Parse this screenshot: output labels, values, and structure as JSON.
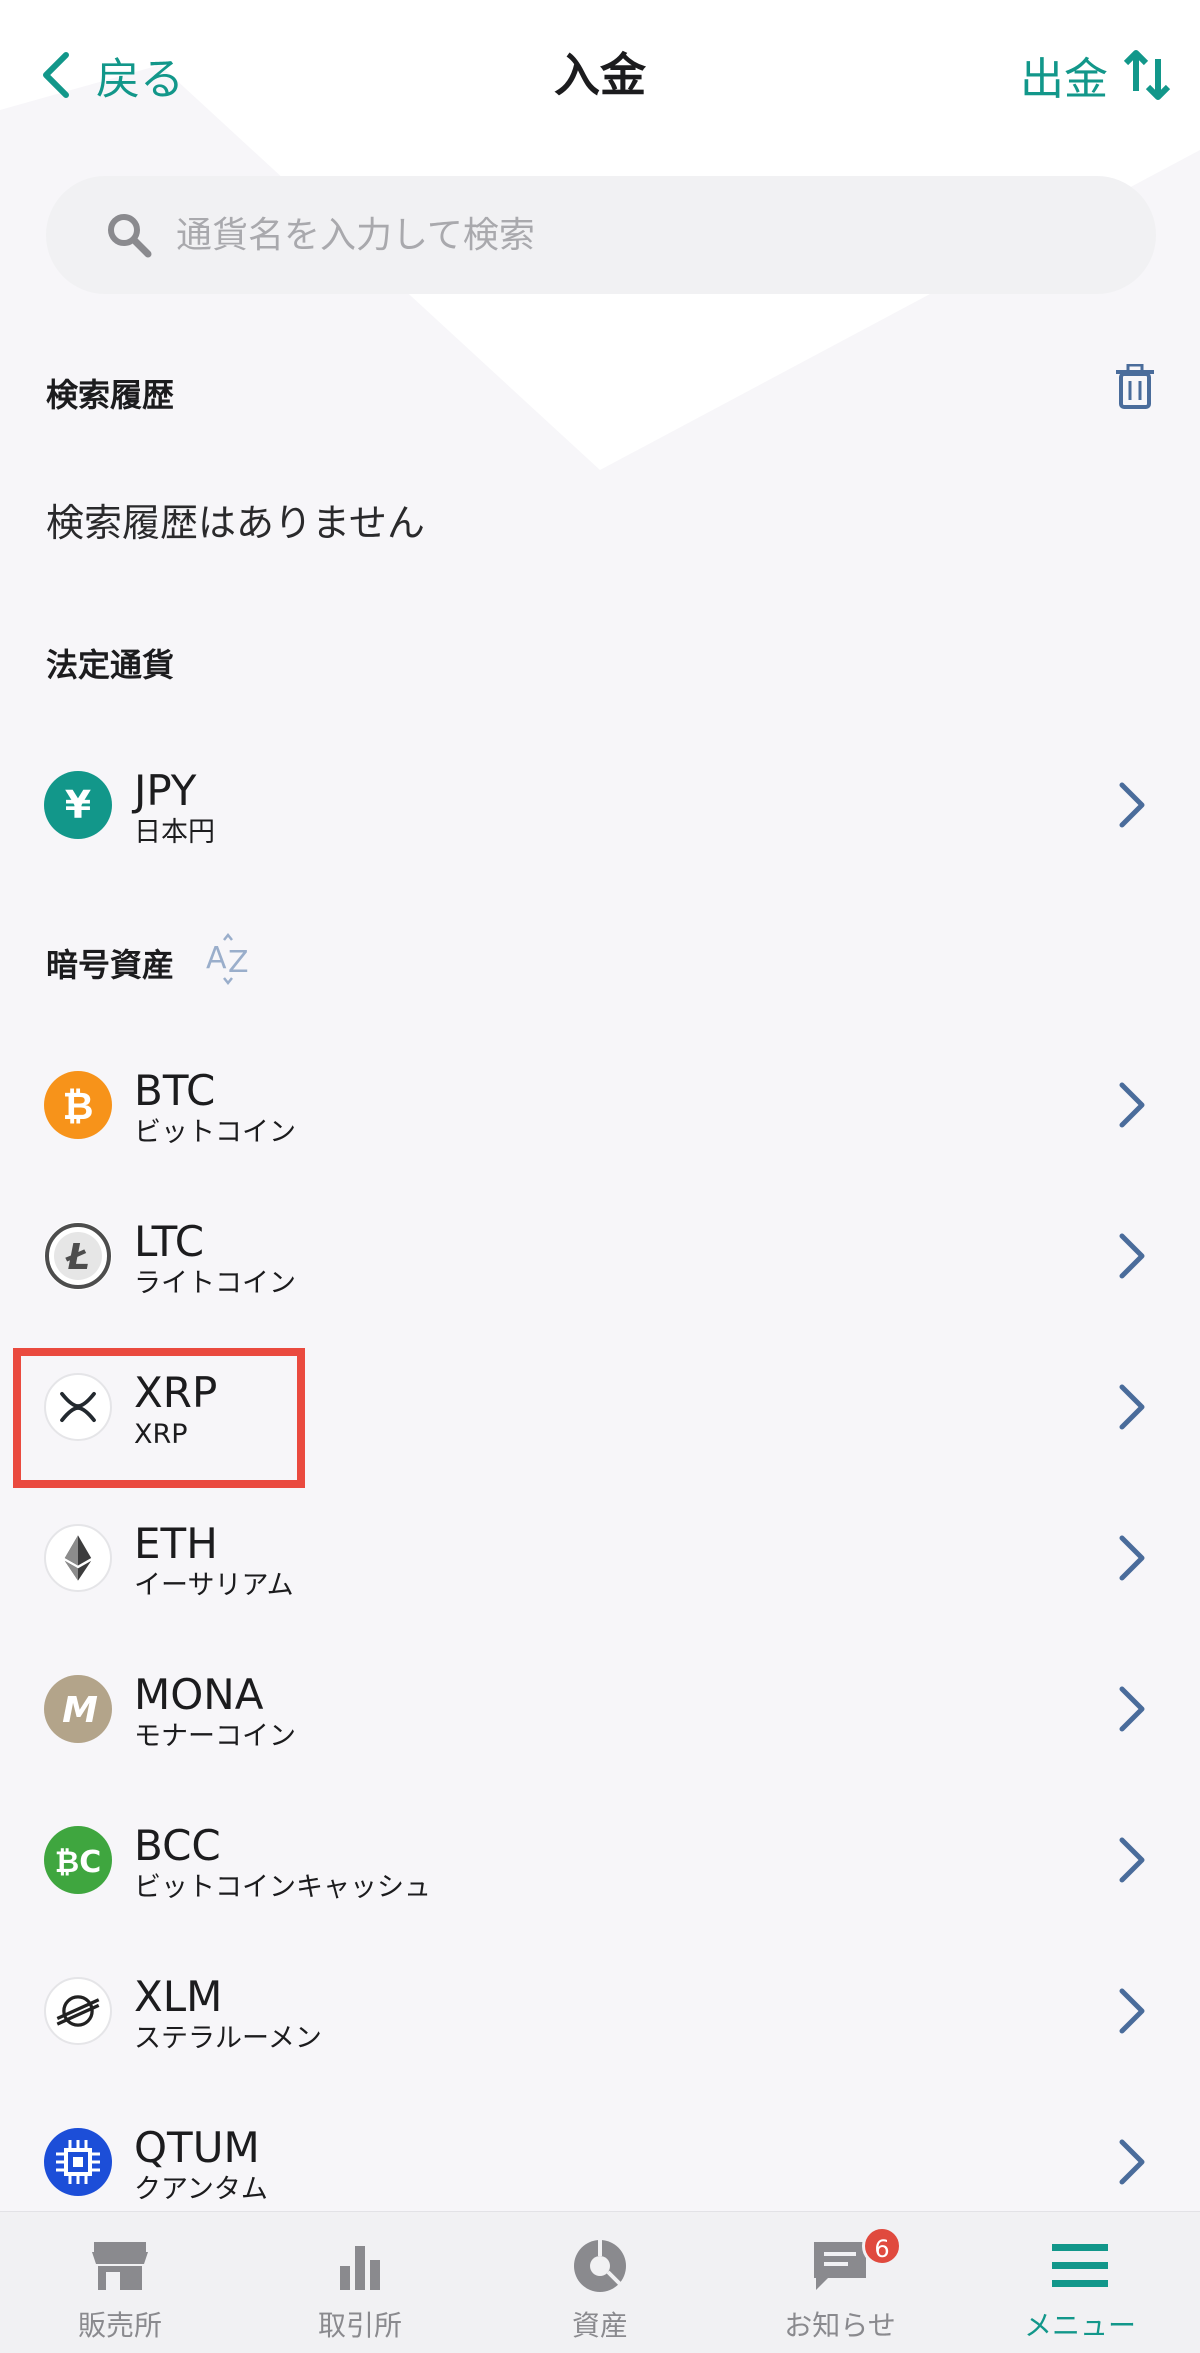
{
  "header": {
    "back_label": "戻る",
    "title": "入金",
    "withdraw_label": "出金"
  },
  "search": {
    "placeholder": "通貨名を入力して検索"
  },
  "history": {
    "title": "検索履歴",
    "empty_text": "検索履歴はありません"
  },
  "fiat": {
    "title": "法定通貨",
    "items": [
      {
        "symbol": "JPY",
        "name": "日本円",
        "icon": "yen-icon",
        "color": "#12978a"
      }
    ]
  },
  "crypto": {
    "title": "暗号資産",
    "sort_icon": "sort-az-icon",
    "items": [
      {
        "symbol": "BTC",
        "name": "ビットコイン",
        "icon": "bitcoin-icon",
        "color": "#f7931a"
      },
      {
        "symbol": "LTC",
        "name": "ライトコイン",
        "icon": "litecoin-icon",
        "color": "#4d4d4d"
      },
      {
        "symbol": "XRP",
        "name": "XRP",
        "icon": "xrp-icon",
        "color": "#23292f"
      },
      {
        "symbol": "ETH",
        "name": "イーサリアム",
        "icon": "ethereum-icon",
        "color": "#3c3c3d"
      },
      {
        "symbol": "MONA",
        "name": "モナーコイン",
        "icon": "monacoin-icon",
        "color": "#b3a48a"
      },
      {
        "symbol": "BCC",
        "name": "ビットコインキャッシュ",
        "icon": "bitcoin-cash-icon",
        "color": "#3fa63f"
      },
      {
        "symbol": "XLM",
        "name": "ステラルーメン",
        "icon": "stellar-icon",
        "color": "#222222"
      },
      {
        "symbol": "QTUM",
        "name": "クアンタム",
        "icon": "qtum-icon",
        "color": "#1c4ed8"
      }
    ]
  },
  "bottom_nav": {
    "items": [
      {
        "label": "販売所",
        "icon": "store-icon"
      },
      {
        "label": "取引所",
        "icon": "bar-chart-icon"
      },
      {
        "label": "資産",
        "icon": "pie-chart-icon"
      },
      {
        "label": "お知らせ",
        "icon": "message-icon",
        "badge": "6"
      },
      {
        "label": "メニュー",
        "icon": "menu-icon",
        "active": true
      }
    ]
  },
  "colors": {
    "accent": "#12978a",
    "chevron": "#4a6c9b",
    "highlight": "#ea4a3f",
    "badge": "#e04a3e"
  }
}
